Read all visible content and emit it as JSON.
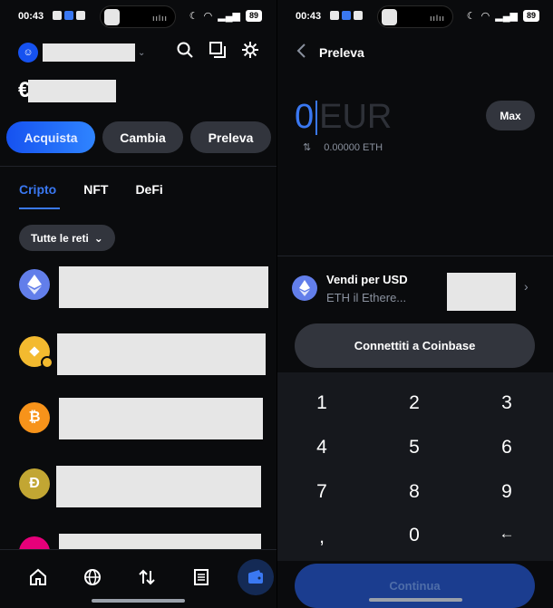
{
  "left": {
    "status": {
      "time": "00:43",
      "battery": "89"
    },
    "balance_currency": "€",
    "actions": {
      "buy": "Acquista",
      "swap": "Cambia",
      "withdraw": "Preleva"
    },
    "tabs": {
      "crypto": "Cripto",
      "nft": "NFT",
      "defi": "DeFi"
    },
    "network_filter": "Tutte le reti",
    "coins": [
      {
        "icon": "ethereum-icon",
        "color": "#627eea"
      },
      {
        "icon": "bnb-icon",
        "color": "#f3ba2f"
      },
      {
        "icon": "bitcoin-icon",
        "color": "#f7931a"
      },
      {
        "icon": "dogecoin-icon",
        "color": "#c2a633"
      }
    ],
    "nav_icons": [
      "home-icon",
      "globe-icon",
      "transfer-icon",
      "list-icon",
      "wallet-icon"
    ]
  },
  "right": {
    "status": {
      "time": "00:43",
      "battery": "89"
    },
    "title": "Preleva",
    "amount": {
      "value": "0",
      "currency": "EUR"
    },
    "max_label": "Max",
    "conversion": "0.00000 ETH",
    "sell": {
      "title": "Vendi per USD",
      "subtitle": "ETH il Ethere..."
    },
    "connect_label": "Connettiti a Coinbase",
    "keys": [
      "1",
      "2",
      "3",
      "4",
      "5",
      "6",
      "7",
      "8",
      "9",
      ",",
      "0",
      "←"
    ],
    "continue_label": "Continua"
  },
  "colors": {
    "accent": "#3a78f2",
    "background": "#0a0b0d",
    "button": "#32353d"
  }
}
